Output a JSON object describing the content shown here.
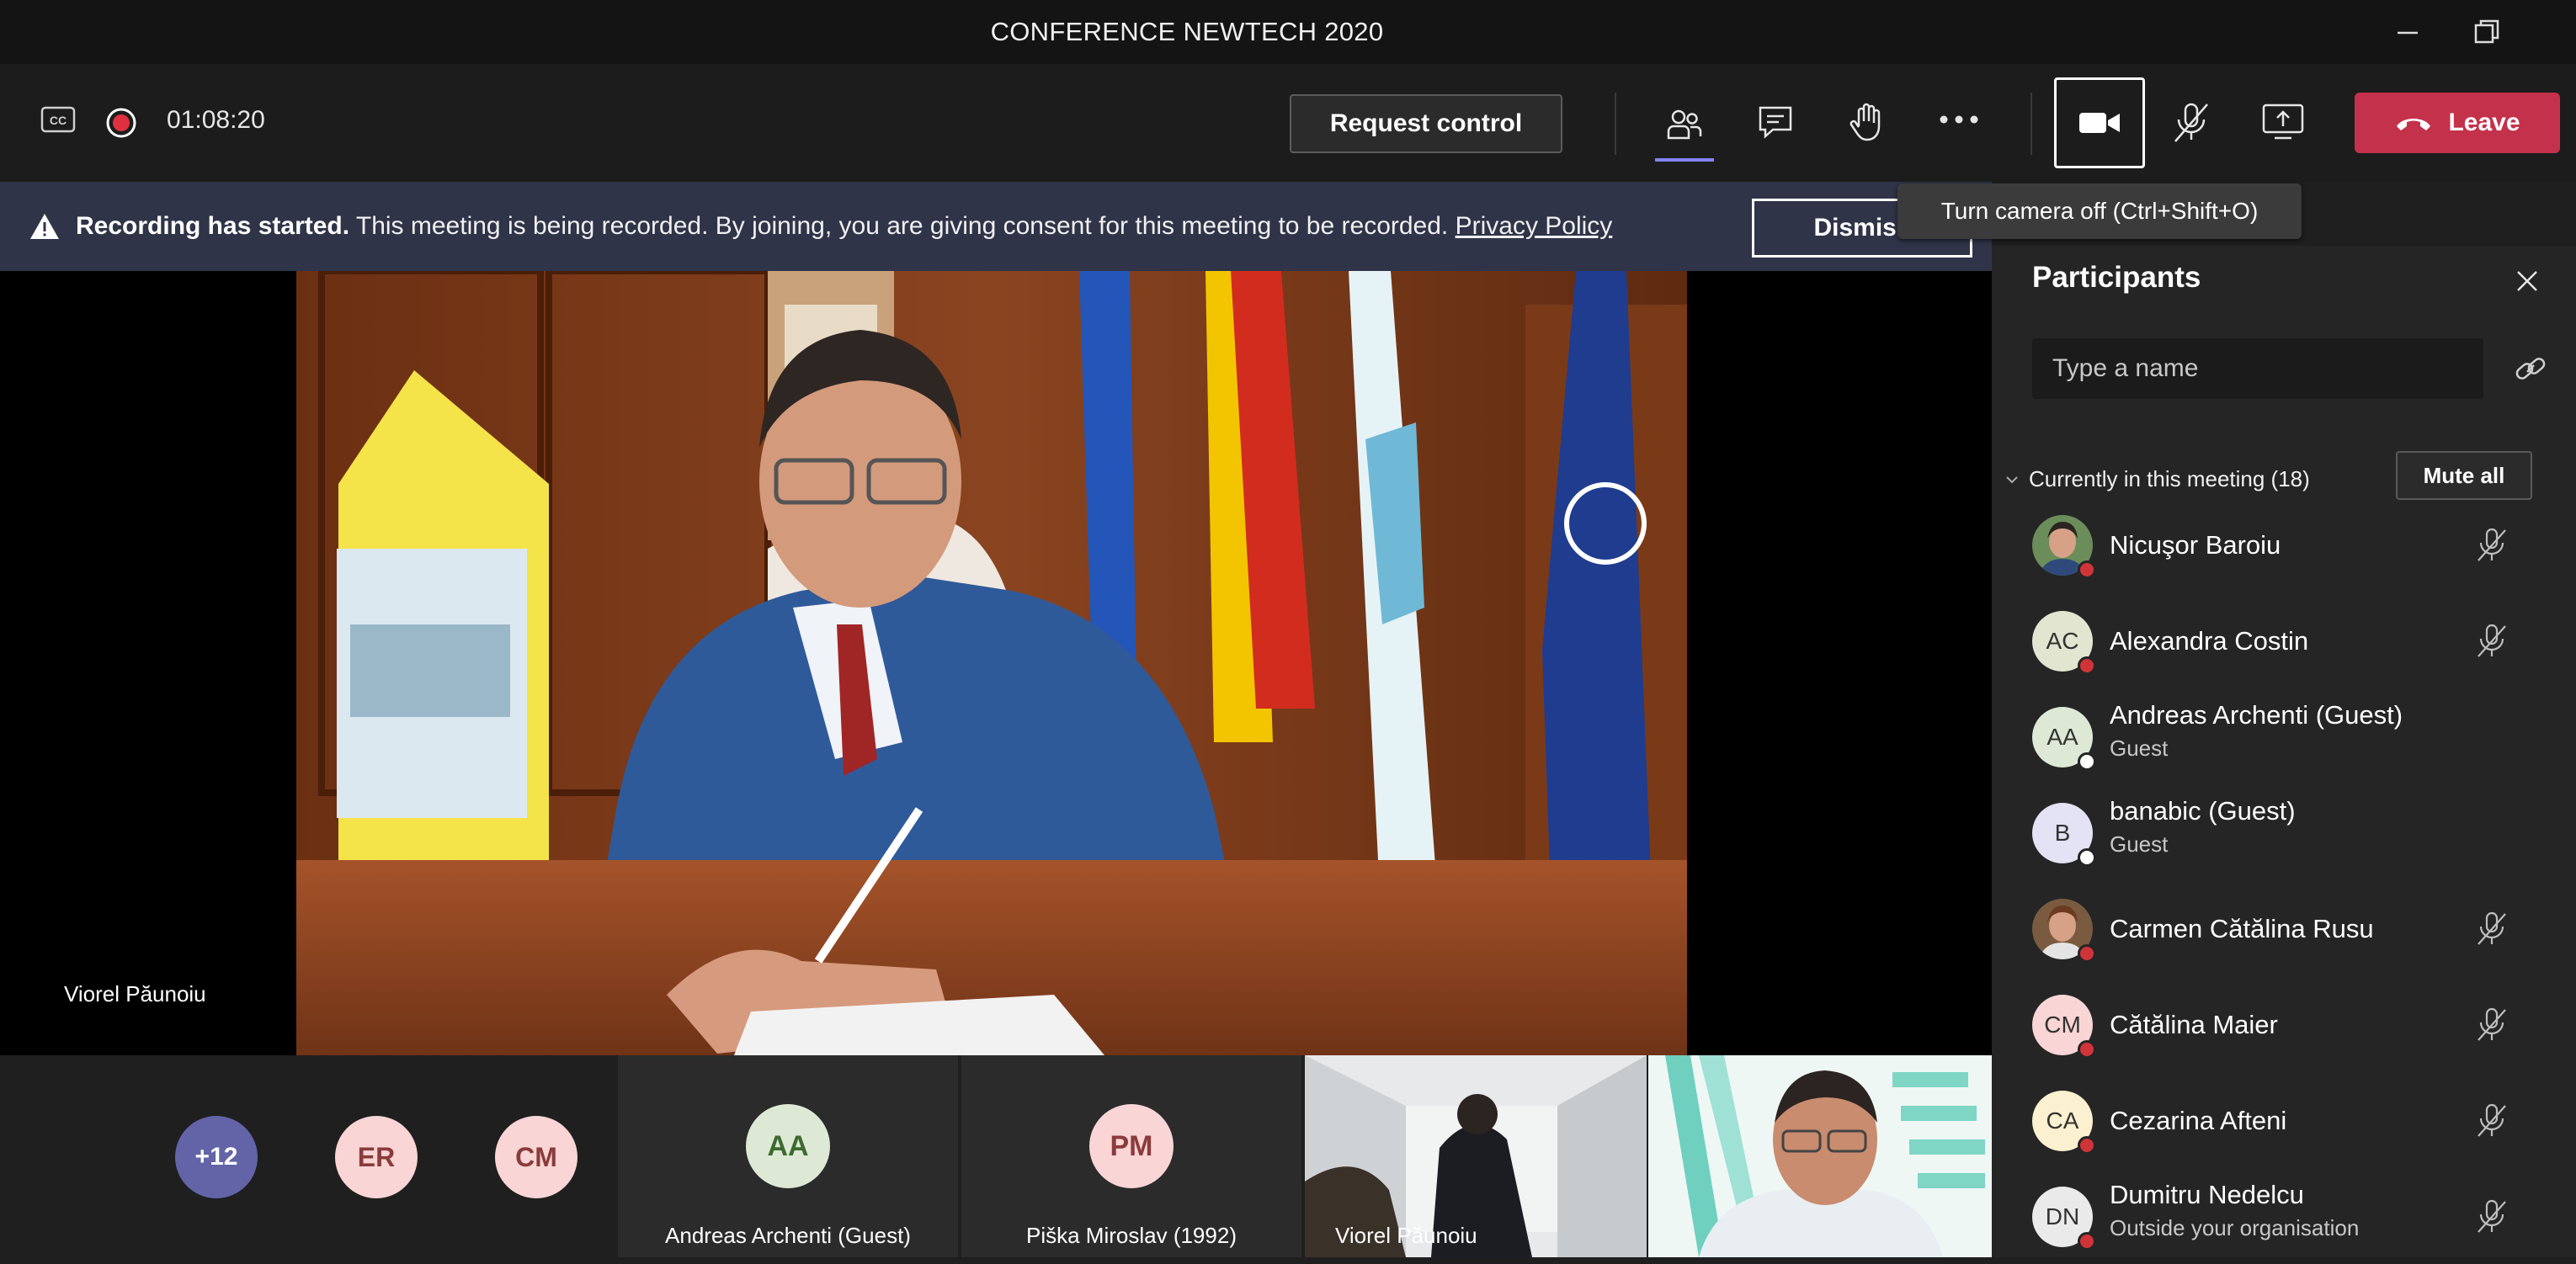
{
  "window": {
    "title": "CONFERENCE NEWTECH 2020"
  },
  "toolbar": {
    "timer": "01:08:20",
    "request_control": "Request control",
    "leave": "Leave",
    "leave_color": "#c4314b"
  },
  "banner": {
    "bold": "Recording has started.",
    "message": " This meeting is being recorded. By joining, you are giving consent for this meeting to be recorded. ",
    "link": "Privacy Policy",
    "dismiss": "Dismiss"
  },
  "tooltip": "Turn camera off (Ctrl+Shift+O)",
  "stage": {
    "speaker": "Viorel Păunoiu"
  },
  "strip": {
    "bubbles": [
      {
        "initials": "+12",
        "bg": "#6264a7",
        "fg": "#ffffff"
      },
      {
        "initials": "ER",
        "bg": "#f9d5d5",
        "fg": "#8a3b3b"
      },
      {
        "initials": "CM",
        "bg": "#f9d5d5",
        "fg": "#8a3b3b"
      }
    ],
    "tiles": [
      {
        "initials": "AA",
        "name": "Andreas Archenti (Guest)",
        "bg": "#dde9d5",
        "fg": "#3d6b2f"
      },
      {
        "initials": "PM",
        "name": "Piška Miroslav (1992)",
        "bg": "#f9d5d5",
        "fg": "#8a3b3b"
      },
      {
        "name": "Viorel Păunoiu"
      }
    ]
  },
  "panel": {
    "title": "Participants",
    "search_placeholder": "Type a name",
    "section": "Currently in this meeting (18)",
    "mute_all": "Mute all",
    "participants": [
      {
        "name": "Nicuşor Baroiu",
        "sub": "",
        "initials": "",
        "photo": true,
        "status": "busy",
        "muted": true
      },
      {
        "name": "Alexandra Costin",
        "sub": "",
        "initials": "AC",
        "bg": "#e2e5d0",
        "status": "busy",
        "muted": true
      },
      {
        "name": "Andreas Archenti (Guest)",
        "sub": "Guest",
        "initials": "AA",
        "bg": "#dde9d5",
        "status": "offline",
        "muted": false
      },
      {
        "name": "banabic (Guest)",
        "sub": "Guest",
        "initials": "B",
        "bg": "#e3e3f5",
        "status": "offline",
        "muted": false
      },
      {
        "name": "Carmen Cătălina Rusu",
        "sub": "",
        "initials": "",
        "photo": true,
        "status": "busy",
        "muted": true
      },
      {
        "name": "Cătălina Maier",
        "sub": "",
        "initials": "CM",
        "bg": "#f9d5d5",
        "status": "busy",
        "muted": true
      },
      {
        "name": "Cezarina Afteni",
        "sub": "",
        "initials": "CA",
        "bg": "#fbf0cf",
        "status": "busy",
        "muted": true
      },
      {
        "name": "Dumitru Nedelcu",
        "sub": "Outside your organisation",
        "initials": "DN",
        "bg": "#eaeaea",
        "status": "busy",
        "muted": true
      }
    ]
  }
}
